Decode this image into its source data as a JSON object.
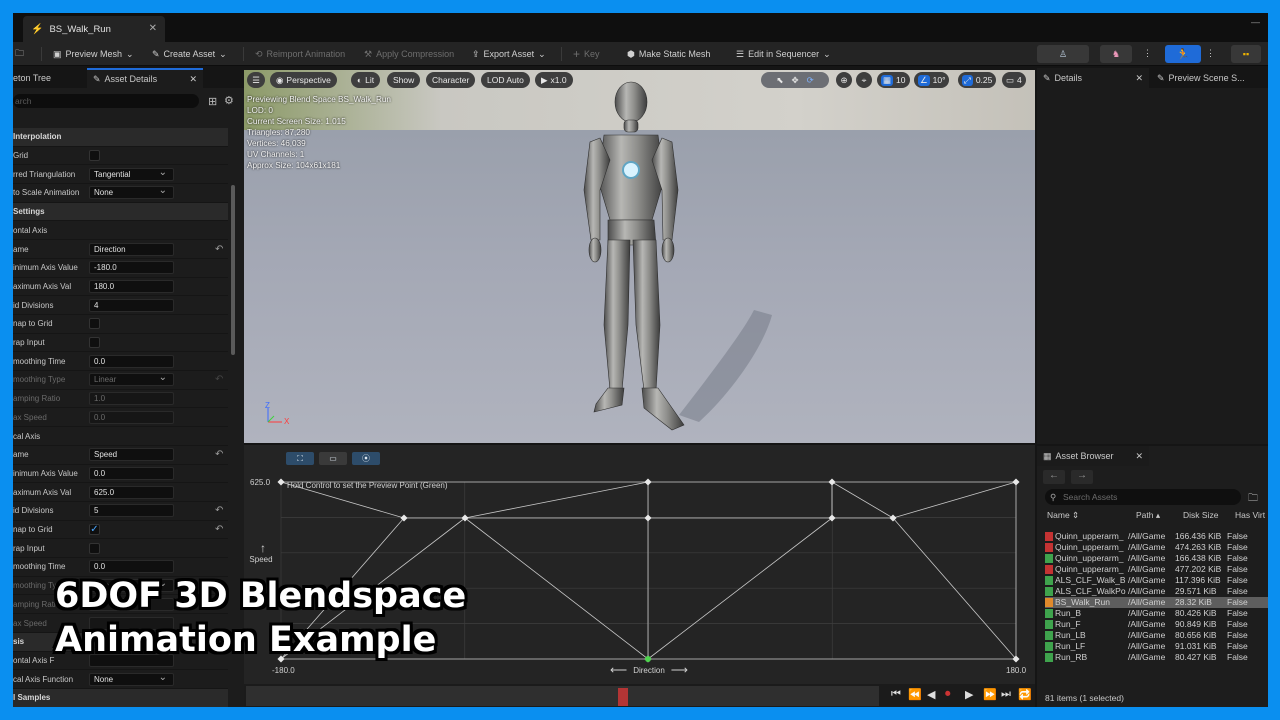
{
  "colors": {
    "frame": "#0a8ff0",
    "accent": "#1f6bd8",
    "selected": "#5e5e5e",
    "record": "#b33535"
  },
  "window": {
    "tab_title": "BS_Walk_Run"
  },
  "toolbar": {
    "preview_mesh": "Preview Mesh",
    "create_asset": "Create Asset",
    "reimport_animation": "Reimport Animation",
    "apply_compression": "Apply Compression",
    "export_asset": "Export Asset",
    "key": "Key",
    "make_static_mesh": "Make Static Mesh",
    "edit_in_sequencer": "Edit in Sequencer"
  },
  "left_panel": {
    "tab_skeleton": "eton Tree",
    "tab_asset_details": "Asset Details",
    "search_placeholder": "arch",
    "rows": [
      {
        "label": "Interpolation",
        "kind": "cat"
      },
      {
        "label": "Grid",
        "kind": "check",
        "checked": false
      },
      {
        "label": "rred Triangulation",
        "kind": "dropdown",
        "value": "Tangential"
      },
      {
        "label": "to Scale Animation",
        "kind": "dropdown",
        "value": "None"
      },
      {
        "label": "Settings",
        "kind": "cat"
      },
      {
        "label": "ontal Axis",
        "kind": "sub"
      },
      {
        "label": "ame",
        "kind": "text",
        "value": "Direction",
        "reset": true
      },
      {
        "label": "inimum Axis Value",
        "kind": "text",
        "value": "-180.0"
      },
      {
        "label": "aximum Axis Val",
        "kind": "text",
        "value": "180.0"
      },
      {
        "label": "id Divisions",
        "kind": "text",
        "value": "4"
      },
      {
        "label": "nap to Grid",
        "kind": "check",
        "checked": false
      },
      {
        "label": "rap Input",
        "kind": "check",
        "checked": false
      },
      {
        "label": "moothing Time",
        "kind": "text",
        "value": "0.0"
      },
      {
        "label": "moothing Type",
        "kind": "dropdown",
        "value": "Linear",
        "dim": true,
        "reset": true
      },
      {
        "label": "amping Ratio",
        "kind": "text",
        "value": "1.0",
        "dim": true
      },
      {
        "label": "ax Speed",
        "kind": "text",
        "value": "0.0",
        "dim": true
      },
      {
        "label": "cal Axis",
        "kind": "sub"
      },
      {
        "label": "ame",
        "kind": "text",
        "value": "Speed",
        "reset": true
      },
      {
        "label": "inimum Axis Value",
        "kind": "text",
        "value": "0.0"
      },
      {
        "label": "aximum Axis Val",
        "kind": "text",
        "value": "625.0"
      },
      {
        "label": "id Divisions",
        "kind": "text",
        "value": "5",
        "reset": true
      },
      {
        "label": "nap to Grid",
        "kind": "check",
        "checked": true,
        "reset": true
      },
      {
        "label": "rap Input",
        "kind": "check",
        "checked": false
      },
      {
        "label": "moothing Time",
        "kind": "text",
        "value": "0.0"
      },
      {
        "label": "moothing Type",
        "kind": "dropdown",
        "value": "Linear",
        "dim": true
      },
      {
        "label": "amping Ratio",
        "kind": "text",
        "value": "",
        "dim": true
      },
      {
        "label": "ax Speed",
        "kind": "text",
        "value": "",
        "dim": true
      },
      {
        "label": "sis",
        "kind": "cat"
      },
      {
        "label": "ontal Axis F",
        "kind": "text",
        "value": ""
      },
      {
        "label": "cal Axis Function",
        "kind": "dropdown",
        "value": "None"
      },
      {
        "label": "l Samples",
        "kind": "cat"
      }
    ]
  },
  "viewport": {
    "perspective": "Perspective",
    "lit": "Lit",
    "show": "Show",
    "character": "Character",
    "lod": "LOD Auto",
    "speed": "x1.0",
    "grid_size": "10",
    "rot_snap": "10°",
    "scale_snap": "0.25",
    "camera_speed": "4",
    "info_lines": [
      "Previewing Blend Space BS_Walk_Run",
      "LOD: 0",
      "Current Screen Size: 1.015",
      "Triangles: 87,280",
      "Vertices: 46,039",
      "UV Channels: 1",
      "Approx Size: 104x61x181"
    ],
    "axis_z": "Z",
    "axis_x": "X"
  },
  "blend_editor": {
    "hint": "Hold Control to set the Preview Point (Green)",
    "y_max": "625.0",
    "x_min": "-180.0",
    "x_max": "180.0",
    "x_label": "Direction",
    "y_label": "Speed"
  },
  "details": {
    "tab_details": "Details",
    "tab_preview": "Preview Scene S..."
  },
  "asset_browser": {
    "title": "Asset Browser",
    "search_placeholder": "Search Assets",
    "col_name": "Name",
    "col_path": "Path",
    "col_size": "Disk Size",
    "col_virtual": "Has Virt",
    "rows": [
      {
        "name": "Quinn_upperarm_",
        "path": "/All/Game",
        "size": "166.436 KiB",
        "virt": "False",
        "type": "red"
      },
      {
        "name": "Quinn_upperarm_",
        "path": "/All/Game",
        "size": "474.263 KiB",
        "virt": "False",
        "type": "red"
      },
      {
        "name": "Quinn_upperarm_",
        "path": "/All/Game",
        "size": "166.438 KiB",
        "virt": "False",
        "type": "green"
      },
      {
        "name": "Quinn_upperarm_",
        "path": "/All/Game",
        "size": "477.202 KiB",
        "virt": "False",
        "type": "red"
      },
      {
        "name": "ALS_CLF_Walk_B",
        "path": "/All/Game",
        "size": "117.396 KiB",
        "virt": "False",
        "type": "green"
      },
      {
        "name": "ALS_CLF_WalkPo",
        "path": "/All/Game",
        "size": "29.571 KiB",
        "virt": "False",
        "type": "green"
      },
      {
        "name": "BS_Walk_Run",
        "path": "/All/Game",
        "size": "28.32 KiB",
        "virt": "False",
        "type": "orange",
        "selected": true
      },
      {
        "name": "Run_B",
        "path": "/All/Game",
        "size": "80.426 KiB",
        "virt": "False",
        "type": "green"
      },
      {
        "name": "Run_F",
        "path": "/All/Game",
        "size": "90.849 KiB",
        "virt": "False",
        "type": "green"
      },
      {
        "name": "Run_LB",
        "path": "/All/Game",
        "size": "80.656 KiB",
        "virt": "False",
        "type": "green"
      },
      {
        "name": "Run_LF",
        "path": "/All/Game",
        "size": "91.031 KiB",
        "virt": "False",
        "type": "green"
      },
      {
        "name": "Run_RB",
        "path": "/All/Game",
        "size": "80.427 KiB",
        "virt": "False",
        "type": "green"
      }
    ],
    "footer": "81 items (1 selected)"
  },
  "overlay": {
    "line1": "6DOF 3D Blendspace",
    "line2": "Animation Example"
  }
}
